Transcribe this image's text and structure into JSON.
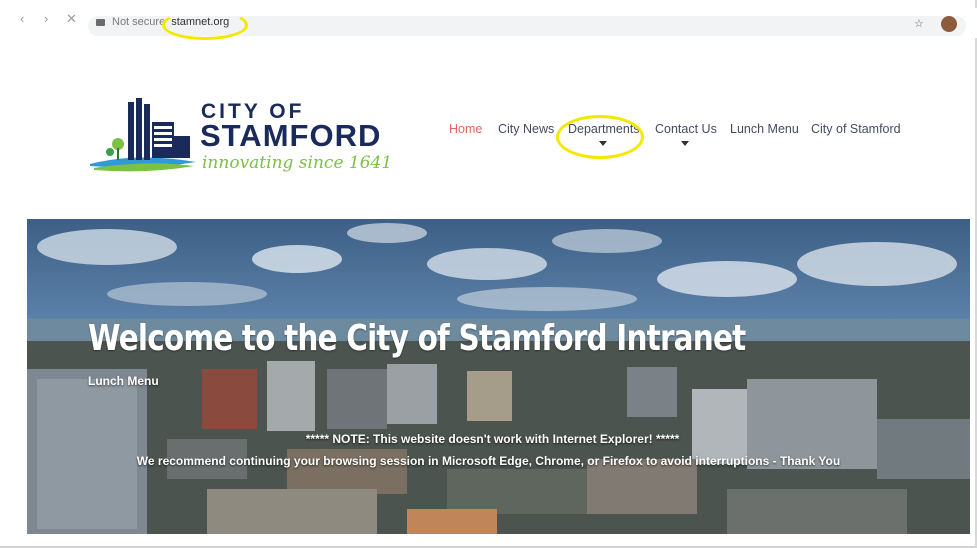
{
  "browser": {
    "back_icon": "arrow-left-icon",
    "forward_icon": "arrow-right-icon",
    "reload_icon": "close-icon",
    "security_label": "Not secure",
    "url_domain": "stamnet.org",
    "bookmark_icon": "star-icon"
  },
  "logo": {
    "line1": "CITY OF",
    "line2": "STAMFORD",
    "tagline": "innovating since 1641"
  },
  "nav": {
    "items": [
      {
        "label": "Home",
        "active": true,
        "dropdown": false
      },
      {
        "label": "City News",
        "active": false,
        "dropdown": false
      },
      {
        "label": "Departments",
        "active": false,
        "dropdown": true
      },
      {
        "label": "Contact Us",
        "active": false,
        "dropdown": true
      },
      {
        "label": "Lunch Menu",
        "active": false,
        "dropdown": false
      },
      {
        "label": "City of Stamford",
        "active": false,
        "dropdown": false
      }
    ]
  },
  "hero": {
    "title": "Welcome to the City of Stamford Intranet",
    "link": "Lunch Menu",
    "notice_line1": "***** NOTE: This website doesn't work with Internet Explorer! *****",
    "notice_line2": "We recommend continuing your browsing session in Microsoft Edge, Chrome, or Firefox to avoid interruptions - Thank You"
  },
  "colors": {
    "nav_active": "#e06a5a",
    "nav_text": "#444a60",
    "logo_blue": "#1a2a5a",
    "logo_green": "#7cc144",
    "highlight": "#f5e800"
  }
}
